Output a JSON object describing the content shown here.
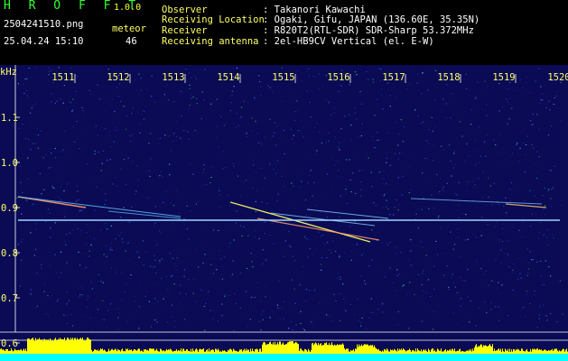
{
  "header": {
    "app_name": "H R O F F T",
    "version": "1.0.0",
    "filename": "2504241510.png",
    "datetime": "25.04.24 15:10",
    "count_label": "meteor",
    "count_value": "46",
    "info": [
      {
        "label": "Observer",
        "value": ": Takanori Kawachi"
      },
      {
        "label": "Receiving Location",
        "value": ": Ogaki, Gifu, JAPAN (136.60E, 35.35N)"
      },
      {
        "label": "Receiver",
        "value": ": R820T2(RTL-SDR) SDR-Sharp 53.372MHz"
      },
      {
        "label": "Receiving antenna",
        "value": ": 2el-HB9CV Vertical (el. E-W)"
      }
    ]
  },
  "spectrogram": {
    "y_unit": "kHz",
    "y_ticks": [
      "1.1",
      "1.0",
      "0.9",
      "0.8",
      "0.7",
      "0.6"
    ],
    "x_ticks": [
      "1511",
      "1512",
      "1513",
      "1514",
      "1515",
      "1516",
      "1517",
      "1518",
      "1519",
      "1520"
    ],
    "beacon_khz": 0.87,
    "colors": {
      "background": "#0a0a55",
      "beacon": "#9fd6ff",
      "meter_yellow": "#ffff00",
      "meter_cyan": "#00ffff"
    }
  }
}
